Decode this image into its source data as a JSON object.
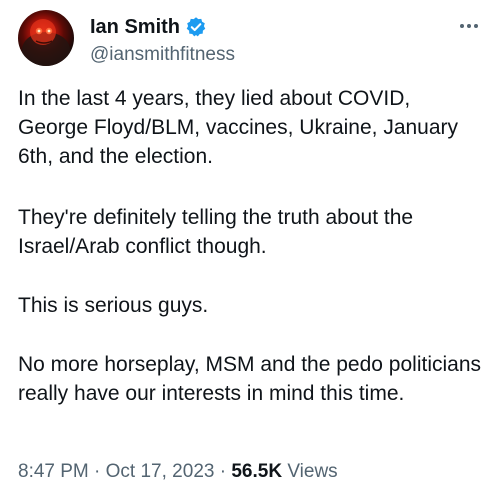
{
  "author": {
    "display_name": "Ian Smith",
    "handle": "@iansmithfitness",
    "verified": true,
    "avatar_icon": "profile-photo"
  },
  "tweet": {
    "paragraphs": [
      "In the last 4 years, they lied about COVID, George Floyd/BLM, vaccines, Ukraine, January 6th, and the election.",
      "They're definitely telling the truth about the Israel/Arab conflict though.",
      "This is serious guys.",
      "No more horseplay, MSM and the pedo politicians really have our interests in mind this time."
    ]
  },
  "meta": {
    "time": "8:47 PM",
    "separator": "·",
    "date": "Oct 17, 2023",
    "views_count": "56.5K",
    "views_label": "Views"
  },
  "icons": {
    "verified": "verified-badge-icon",
    "more": "more-options-icon"
  },
  "colors": {
    "verified_blue": "#1d9bf0",
    "text_primary": "#0f1419",
    "text_secondary": "#536471"
  }
}
